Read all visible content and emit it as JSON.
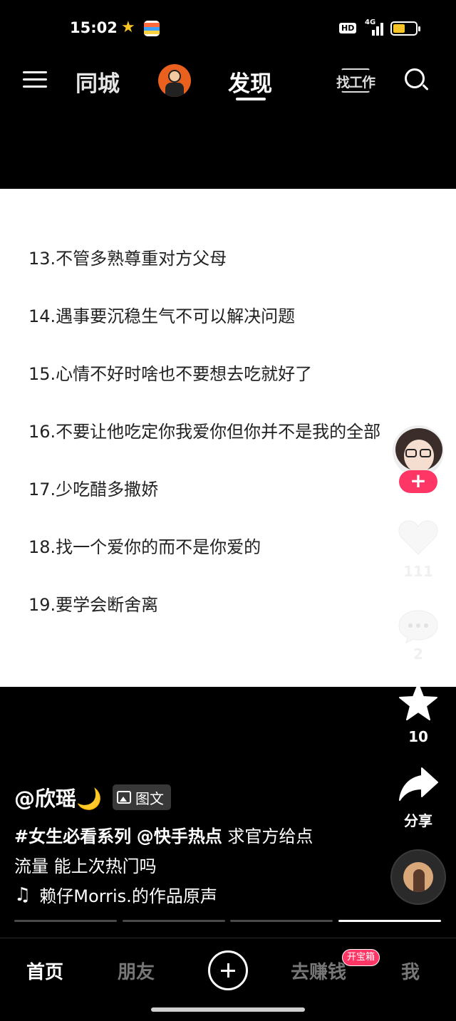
{
  "status_bar": {
    "time": "15:02",
    "star_icon": "star-icon",
    "hd_label": "HD",
    "network_label": "4G",
    "battery_color": "#f7c325"
  },
  "top_nav": {
    "tab_city": "同城",
    "tab_discover": "发现",
    "job_label": "找工作"
  },
  "content": {
    "items": [
      "13.不管多熟尊重对方父母",
      "14.遇事要沉稳生气不可以解决问题",
      "15.心情不好时啥也不要想去吃就好了",
      "16.不要让他吃定你我爱你但你并不是我的全部",
      "17.少吃醋多撒娇",
      "18.找一个爱你的而不是你爱的",
      "19.要学会断舍离"
    ]
  },
  "actions": {
    "follow_label": "+",
    "like_count": "111",
    "comment_count": "2",
    "favorite_count": "10",
    "share_label": "分享",
    "accent_color": "#fe3666"
  },
  "post": {
    "author": "@欣瑶",
    "author_emoji": "🌙",
    "type_badge": "图文",
    "hashtag": "#女生必看系列",
    "mention": "@快手热点",
    "caption_rest": " 求官方给点",
    "caption_line2": "流量 能上次热门吗",
    "music": "赖仔Morris.的作品原声",
    "progress_segments": 4,
    "active_segment": 4
  },
  "bottom_nav": {
    "home": "首页",
    "friends": "朋友",
    "earn": "去赚钱",
    "earn_badge": "开宝箱",
    "me": "我"
  }
}
